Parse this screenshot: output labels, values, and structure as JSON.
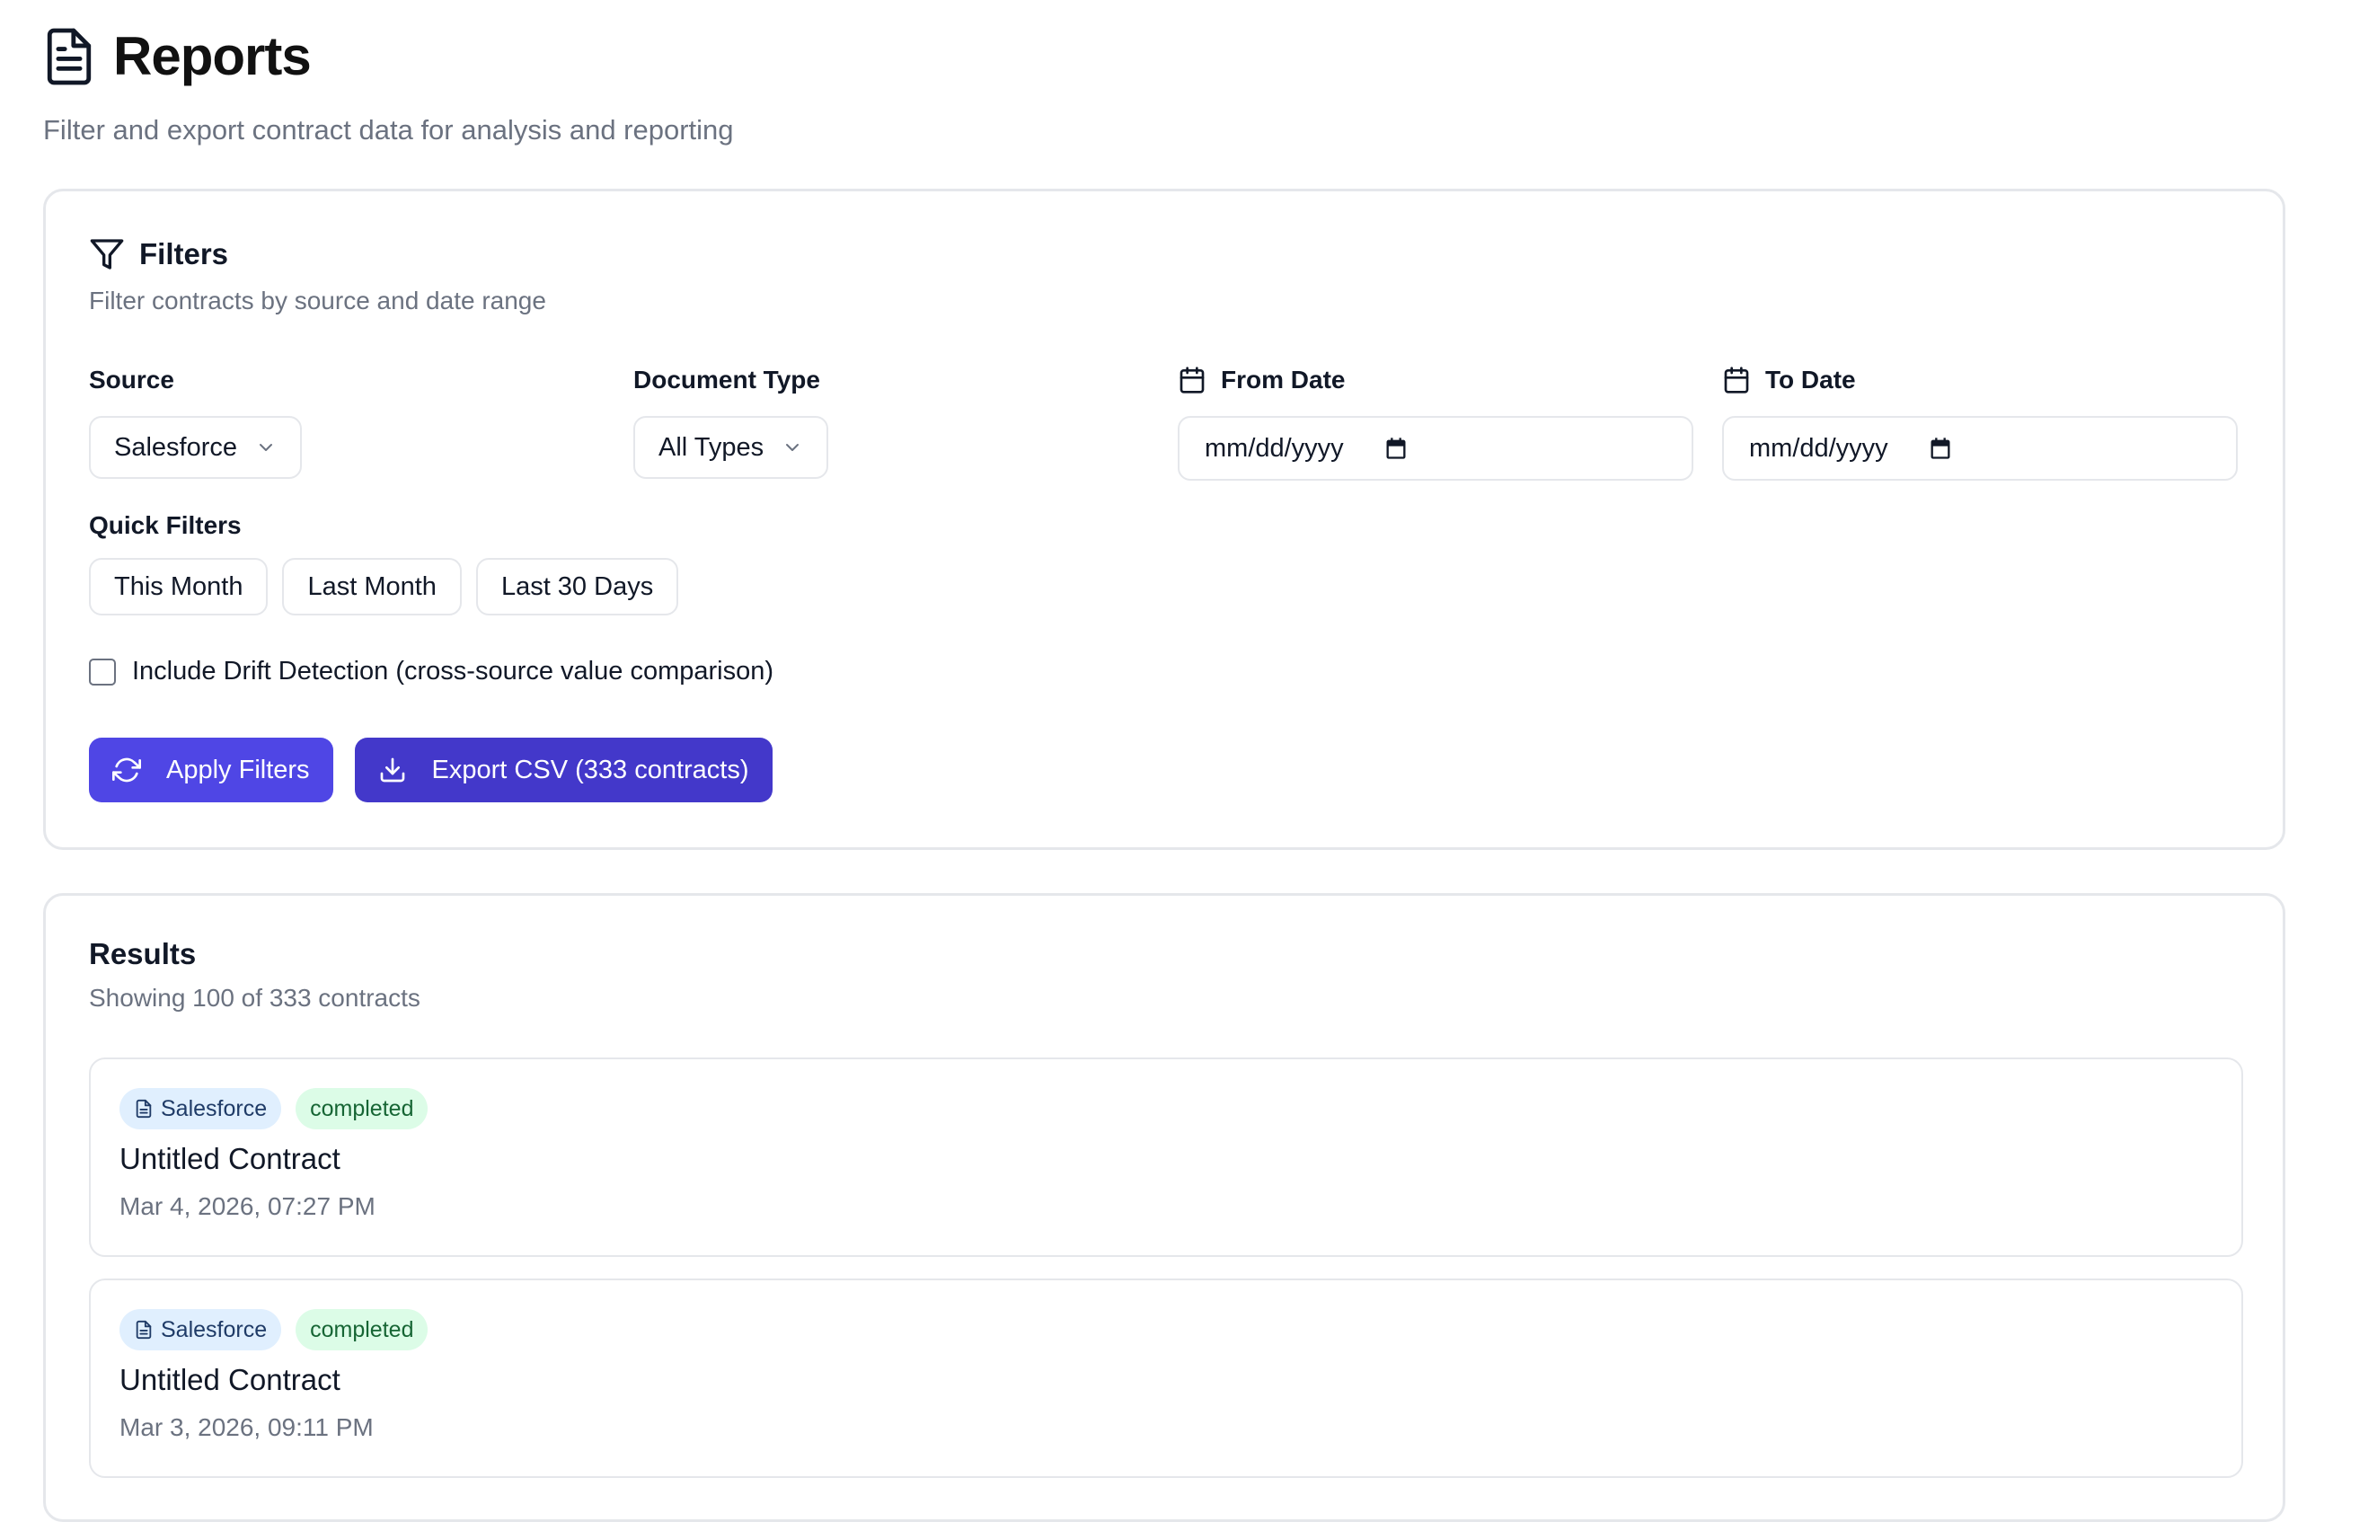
{
  "header": {
    "title": "Reports",
    "subtitle": "Filter and export contract data for analysis and reporting",
    "icon": "file-text-icon"
  },
  "filters": {
    "title": "Filters",
    "description": "Filter contracts by source and date range",
    "source": {
      "label": "Source",
      "value": "Salesforce"
    },
    "document_type": {
      "label": "Document Type",
      "value": "All Types"
    },
    "from_date": {
      "label": "From Date",
      "value": "mm/dd/yyyy"
    },
    "to_date": {
      "label": "To Date",
      "value": "mm/dd/yyyy"
    },
    "quick_filters": {
      "label": "Quick Filters",
      "items": [
        "This Month",
        "Last Month",
        "Last 30 Days"
      ]
    },
    "drift_checkbox": {
      "label": "Include Drift Detection (cross-source value comparison)",
      "checked": false
    },
    "apply_label": "Apply Filters",
    "export_label": "Export CSV (333 contracts)"
  },
  "results": {
    "title": "Results",
    "description": "Showing 100 of 333 contracts",
    "items": [
      {
        "source": "Salesforce",
        "status": "completed",
        "title": "Untitled Contract",
        "date": "Mar 4, 2026, 07:27 PM"
      },
      {
        "source": "Salesforce",
        "status": "completed",
        "title": "Untitled Contract",
        "date": "Mar 3, 2026, 09:11 PM"
      }
    ]
  },
  "colors": {
    "primary": "#4f46e5",
    "primary_dark": "#4338ca",
    "source_badge_bg": "#e0effe",
    "status_badge_bg": "#dcfce7",
    "status_badge_text": "#166534"
  }
}
